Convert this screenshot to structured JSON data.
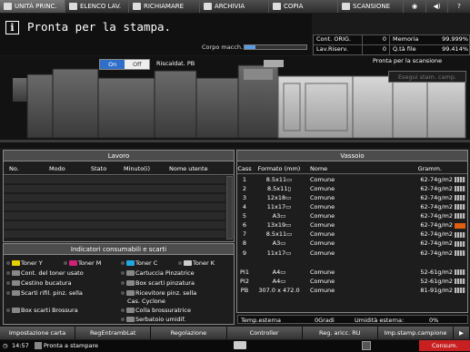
{
  "tabs": [
    {
      "label": "UNITÀ PRINC.",
      "icon": "home-icon"
    },
    {
      "label": "ELENCO LAV.",
      "icon": "job-list-icon"
    },
    {
      "label": "RICHIAMARE",
      "icon": "recall-icon"
    },
    {
      "label": "ARCHIVIA",
      "icon": "archive-icon"
    },
    {
      "label": "COPIA",
      "icon": "copy-icon"
    },
    {
      "label": "SCANSIONE",
      "icon": "scan-icon"
    }
  ],
  "status": {
    "message": "Pronta per la stampa.",
    "corpo_label": "Corpo macch.",
    "corpo_level": 0.17
  },
  "counters": {
    "cont_orig_label": "Cont. ORIG.",
    "cont_orig_value": "0",
    "memoria_label": "Memoria",
    "memoria_value": "99.999%",
    "lav_riserv_label": "Lav.Riserv.",
    "lav_riserv_value": "0",
    "qta_file_label": "Q.tà file",
    "qta_file_value": "99.414%"
  },
  "machine": {
    "on_label": "On",
    "off_label": "Off",
    "riscald_label": "Riscaldat. PB",
    "scan_ready": "Pronta per la scansione",
    "esegui_label": "Esegui stam. camp."
  },
  "lavoro": {
    "title": "Lavoro",
    "columns": [
      "No.",
      "Modo",
      "Stato",
      "Minuto(i)",
      "Nome utente"
    ]
  },
  "consumables": {
    "title": "Indicatori consumabili e scarti",
    "items": [
      {
        "label": "Toner Y",
        "color": "#e8d000"
      },
      {
        "label": "Toner M",
        "color": "#d0207a"
      },
      {
        "label": "Toner C",
        "color": "#20a8e0"
      },
      {
        "label": "Toner K",
        "color": "#cccccc"
      },
      {
        "label": "Cont. del toner usato",
        "color": "#888888"
      },
      {
        "label": "Cartuccia Pinzatrice",
        "color": "#888888"
      },
      {
        "label": "Cestino bucatura",
        "color": "#888888"
      },
      {
        "label": "Box scarti pinzatura",
        "color": "#888888"
      },
      {
        "label": "Scarti rifil. pinz. sella",
        "color": "#888888"
      },
      {
        "label": "Ricevitore pinz. sella",
        "color": "#888888"
      },
      {
        "label": "Cas. Cyclone",
        "color": "#888888"
      },
      {
        "label": "Box scarti Brossura",
        "color": "#888888"
      },
      {
        "label": "Colla brossuratrice",
        "color": "#888888"
      },
      {
        "label": "Serbatoio umidif.",
        "color": "#888888"
      }
    ]
  },
  "vassoio": {
    "title": "Vassoio",
    "columns": [
      "Cass",
      "Formato (mm)",
      "Nome",
      "Gramm."
    ],
    "rows": [
      {
        "cass": "1",
        "formato": "8.5x11▭",
        "nome": "Comune",
        "gramm": "62-74g/m2",
        "warn": false
      },
      {
        "cass": "2",
        "formato": "8.5x11▯",
        "nome": "Comune",
        "gramm": "62-74g/m2",
        "warn": false
      },
      {
        "cass": "3",
        "formato": "12x18▭",
        "nome": "Comune",
        "gramm": "62-74g/m2",
        "warn": false
      },
      {
        "cass": "4",
        "formato": "11x17▭",
        "nome": "Comune",
        "gramm": "62-74g/m2",
        "warn": false
      },
      {
        "cass": "5",
        "formato": "A3▭",
        "nome": "Comune",
        "gramm": "62-74g/m2",
        "warn": false
      },
      {
        "cass": "6",
        "formato": "13x19▭",
        "nome": "Comune",
        "gramm": "62-74g/m2",
        "warn": true
      },
      {
        "cass": "7",
        "formato": "8.5x11▭",
        "nome": "Comune",
        "gramm": "62-74g/m2",
        "warn": false
      },
      {
        "cass": "8",
        "formato": "A3▭",
        "nome": "Comune",
        "gramm": "62-74g/m2",
        "warn": false
      },
      {
        "cass": "9",
        "formato": "11x17▭",
        "nome": "Comune",
        "gramm": "62-74g/m2",
        "warn": false
      },
      {
        "cass": "PI1",
        "formato": "A4▭",
        "nome": "Comune",
        "gramm": "52-61g/m2",
        "warn": false
      },
      {
        "cass": "PI2",
        "formato": "A4▭",
        "nome": "Comune",
        "gramm": "52-61g/m2",
        "warn": false
      },
      {
        "cass": "PB",
        "formato": "307.0 x 472.0",
        "nome": "Comune",
        "gramm": "81-91g/m2",
        "warn": false
      }
    ],
    "temp_label": "Temp.esterna",
    "temp_value": "0Gradi",
    "umid_label": "Umidità esterna:",
    "umid_value": "0%"
  },
  "bottom_buttons": [
    "Impostazione carta",
    "RegEntrambLat",
    "Regolazione",
    "Controller",
    "Reg. aricc. RU",
    "Imp.stamp.campione"
  ],
  "statusline": {
    "time": "14:57",
    "message": "Pronta a stampare",
    "consum_label": "Consum."
  }
}
